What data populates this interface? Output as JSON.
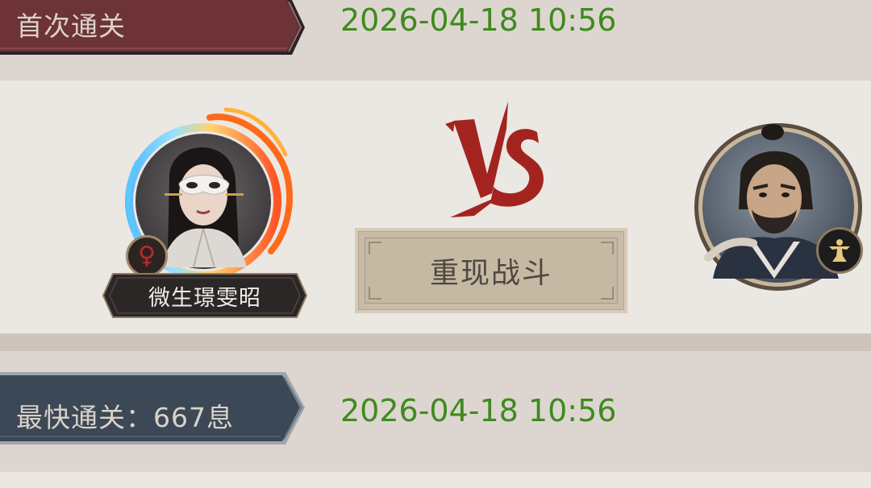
{
  "first_clear": {
    "label": "首次通关",
    "timestamp": "2026-04-18 10:56"
  },
  "battle": {
    "player": {
      "name": "微生璟雯昭",
      "gender_symbol": "♀"
    },
    "vs_text": "VS",
    "replay_button_label": "重现战斗"
  },
  "fastest_clear": {
    "label": "最快通关：667息",
    "timestamp": "2026-04-18 10:56"
  },
  "colors": {
    "first_clear_ribbon": "#6d3336",
    "fastest_clear_ribbon": "#3c4855",
    "timestamp_green": "#3f8a1f",
    "vs_red": "#a3241f"
  }
}
